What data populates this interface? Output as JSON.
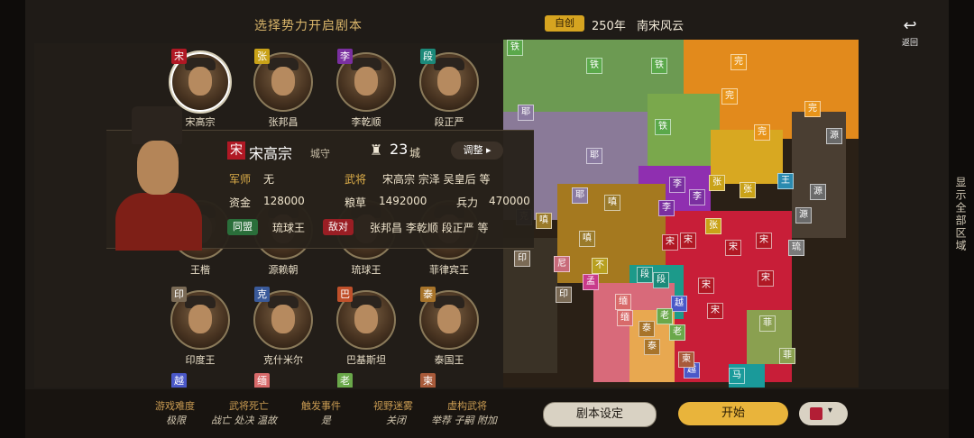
{
  "header": {
    "title": "选择势力开启剧本",
    "custom_tag": "自创",
    "year": "250年",
    "scenario_name": "南宋风云",
    "back_icon": "↩",
    "back_label": "返回",
    "side_label": "显示全部区域"
  },
  "lords": [
    {
      "badge": "宋",
      "badge_color": "#b01824",
      "name": "宋高宗",
      "selected": true
    },
    {
      "badge": "张",
      "badge_color": "#c9a218",
      "name": "张邦昌",
      "selected": false
    },
    {
      "badge": "李",
      "badge_color": "#7a2fa0",
      "name": "李乾顺",
      "selected": false
    },
    {
      "badge": "段",
      "badge_color": "#1c8a7a",
      "name": "段正严",
      "selected": false
    },
    {
      "badge": "",
      "badge_color": "#555555",
      "name": "王楷",
      "selected": false
    },
    {
      "badge": "",
      "badge_color": "#555555",
      "name": "源赖朝",
      "selected": false
    },
    {
      "badge": "",
      "badge_color": "#555555",
      "name": "琉球王",
      "selected": false
    },
    {
      "badge": "",
      "badge_color": "#555555",
      "name": "菲律宾王",
      "selected": false
    },
    {
      "badge": "印",
      "badge_color": "#7a6a55",
      "name": "印度王",
      "selected": false
    },
    {
      "badge": "克",
      "badge_color": "#3a5a9a",
      "name": "克什米尔",
      "selected": false
    },
    {
      "badge": "巴",
      "badge_color": "#c0502a",
      "name": "巴基斯坦",
      "selected": false
    },
    {
      "badge": "泰",
      "badge_color": "#a8742a",
      "name": "泰国王",
      "selected": false
    },
    {
      "badge": "越",
      "badge_color": "#4a58c8",
      "name": "",
      "selected": false
    },
    {
      "badge": "缅",
      "badge_color": "#d86a6a",
      "name": "",
      "selected": false
    },
    {
      "badge": "老",
      "badge_color": "#6aa84a",
      "name": "",
      "selected": false
    },
    {
      "badge": "柬",
      "badge_color": "#a85a3a",
      "name": "",
      "selected": false
    }
  ],
  "info": {
    "ruler_badge": "宋",
    "ruler_name": "宋高宗",
    "ruler_trait": "城守",
    "castle_icon": "♜",
    "city_count": "23",
    "city_unit": "城",
    "adjust_label": "调整 ▸",
    "strategist_label": "军师",
    "strategist_value": "无",
    "generals_label": "武将",
    "generals_value": "宋高宗 宗泽 吴皇后 等",
    "funds_label": "资金",
    "funds_value": "128000",
    "food_label": "粮草",
    "food_value": "1492000",
    "troops_label": "兵力",
    "troops_value": "470000",
    "ally_label": "同盟",
    "ally_value": "琉球王",
    "enemy_label": "敌对",
    "enemy_value": "张邦昌 李乾顺 段正严 等"
  },
  "map_markers": [
    {
      "t": "铁",
      "c": "#5aa84a"
    },
    {
      "t": "铁",
      "c": "#5aa84a"
    },
    {
      "t": "铁",
      "c": "#5aa84a"
    },
    {
      "t": "铁",
      "c": "#5aa84a"
    },
    {
      "t": "完",
      "c": "#e8941a"
    },
    {
      "t": "完",
      "c": "#e8941a"
    },
    {
      "t": "完",
      "c": "#e8941a"
    },
    {
      "t": "完",
      "c": "#e8941a"
    },
    {
      "t": "耶",
      "c": "#8a7aa0"
    },
    {
      "t": "耶",
      "c": "#8a7aa0"
    },
    {
      "t": "耶",
      "c": "#8a7aa0"
    },
    {
      "t": "李",
      "c": "#7a2fa0"
    },
    {
      "t": "李",
      "c": "#7a2fa0"
    },
    {
      "t": "李",
      "c": "#7a2fa0"
    },
    {
      "t": "张",
      "c": "#c9a218"
    },
    {
      "t": "张",
      "c": "#c9a218"
    },
    {
      "t": "张",
      "c": "#c9a218"
    },
    {
      "t": "宋",
      "c": "#b01824"
    },
    {
      "t": "宋",
      "c": "#b01824"
    },
    {
      "t": "宋",
      "c": "#b01824"
    },
    {
      "t": "宋",
      "c": "#b01824"
    },
    {
      "t": "宋",
      "c": "#b01824"
    },
    {
      "t": "宋",
      "c": "#b01824"
    },
    {
      "t": "宋",
      "c": "#b01824"
    },
    {
      "t": "嗔",
      "c": "#9a7a2a"
    },
    {
      "t": "嗔",
      "c": "#9a7a2a"
    },
    {
      "t": "嗔",
      "c": "#9a7a2a"
    },
    {
      "t": "源",
      "c": "#6a6a6a"
    },
    {
      "t": "源",
      "c": "#6a6a6a"
    },
    {
      "t": "源",
      "c": "#6a6a6a"
    },
    {
      "t": "段",
      "c": "#1c8a7a"
    },
    {
      "t": "段",
      "c": "#1c8a7a"
    },
    {
      "t": "印",
      "c": "#7a6a55"
    },
    {
      "t": "印",
      "c": "#7a6a55"
    },
    {
      "t": "尼",
      "c": "#c86a7a"
    },
    {
      "t": "缅",
      "c": "#d86a6a"
    },
    {
      "t": "缅",
      "c": "#d86a6a"
    },
    {
      "t": "越",
      "c": "#4a58c8"
    },
    {
      "t": "越",
      "c": "#4a58c8"
    },
    {
      "t": "老",
      "c": "#6aa84a"
    },
    {
      "t": "老",
      "c": "#6aa84a"
    },
    {
      "t": "泰",
      "c": "#a8742a"
    },
    {
      "t": "泰",
      "c": "#a8742a"
    },
    {
      "t": "柬",
      "c": "#a85a3a"
    },
    {
      "t": "菲",
      "c": "#8aa050"
    },
    {
      "t": "菲",
      "c": "#8aa050"
    },
    {
      "t": "琉",
      "c": "#7a7a7a"
    },
    {
      "t": "王",
      "c": "#2a8ab0"
    },
    {
      "t": "克",
      "c": "#3a5a9a"
    },
    {
      "t": "不",
      "c": "#b8a020"
    },
    {
      "t": "孟",
      "c": "#c83a8a"
    },
    {
      "t": "马",
      "c": "#1a9a9a"
    }
  ],
  "options": [
    {
      "title": "游戏难度",
      "value": "极限"
    },
    {
      "title": "武将死亡",
      "value": "战亡 处决 温故"
    },
    {
      "title": "触发事件",
      "value": "是"
    },
    {
      "title": "视野迷雾",
      "value": "关闭"
    },
    {
      "title": "虚构武将",
      "value": "举荐 子嗣 附加"
    }
  ],
  "buttons": {
    "settings": "剧本设定",
    "start": "开始",
    "color_caret": "▾",
    "player_color": "#b21e35"
  }
}
